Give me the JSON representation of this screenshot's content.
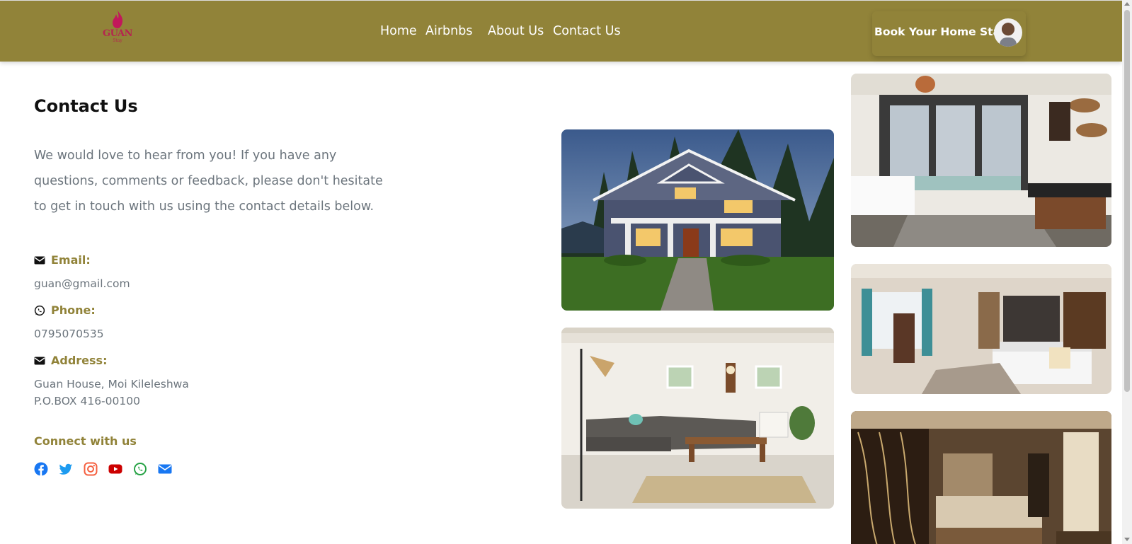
{
  "nav": {
    "logo": {
      "name": "GUAN",
      "sub": "Stay"
    },
    "links": [
      {
        "label": "Home"
      },
      {
        "label": "Airbnbs"
      },
      {
        "label": "About Us"
      },
      {
        "label": "Contact Us"
      }
    ],
    "cta": {
      "label": "Book Your Home Stay"
    }
  },
  "contact": {
    "title": "Contact Us",
    "intro": "We would love to hear from you! If you have any questions, comments or feedback, please don't hesitate to get in touch with us using the contact details below.",
    "email": {
      "label": "Email:",
      "value": "guan@gmail.com",
      "icon": "envelope-icon"
    },
    "phone": {
      "label": "Phone:",
      "value": "0795070535",
      "icon": "whatsapp-icon"
    },
    "address": {
      "label": "Address:",
      "line1": "Guan House, Moi Kileleshwa",
      "line2": "P.O.BOX 416-00100",
      "icon": "envelope-icon"
    },
    "connect_label": "Connect with us",
    "socials": [
      {
        "name": "facebook-icon",
        "color": "#1877f2"
      },
      {
        "name": "twitter-icon",
        "color": "#1d9bf0"
      },
      {
        "name": "instagram-icon",
        "color": "#f56040"
      },
      {
        "name": "youtube-icon",
        "color": "#cc0000"
      },
      {
        "name": "whatsapp-icon",
        "color": "#25a244"
      },
      {
        "name": "email-icon",
        "color": "#1877f2"
      }
    ]
  },
  "colors": {
    "brand": "#918339",
    "text_muted": "#6c757d",
    "logo": "#b5264f"
  }
}
